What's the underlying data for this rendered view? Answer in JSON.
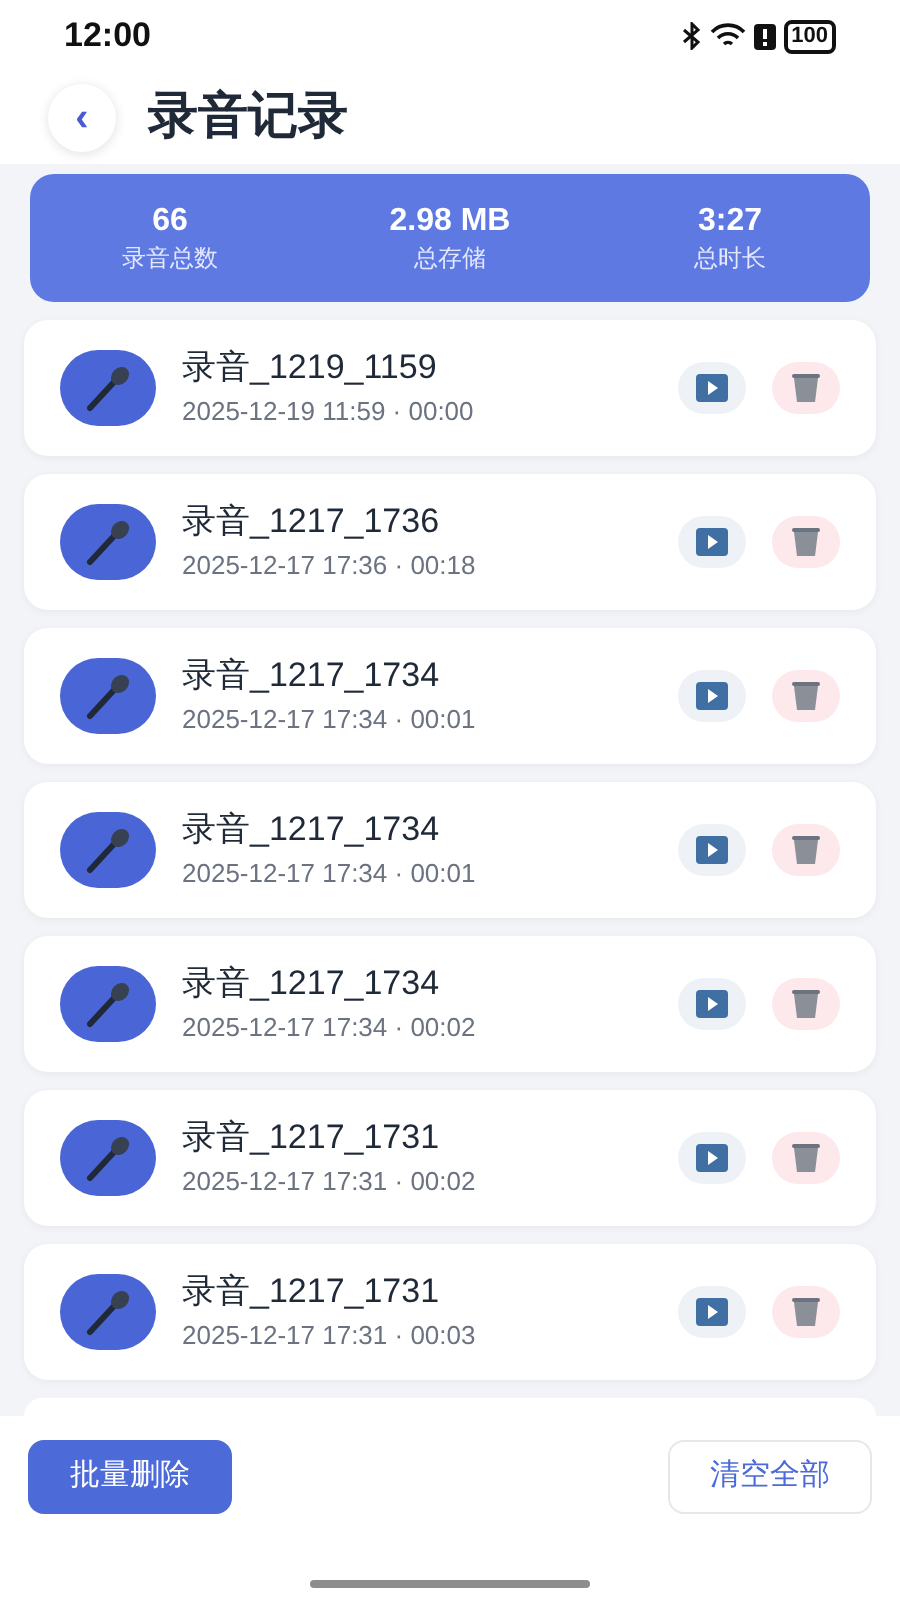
{
  "status_bar": {
    "time": "12:00",
    "battery": "100"
  },
  "header": {
    "back": "‹",
    "title": "录音记录"
  },
  "stats": [
    {
      "value": "66",
      "label": "录音总数"
    },
    {
      "value": "2.98 MB",
      "label": "总存储"
    },
    {
      "value": "3:27",
      "label": "总时长"
    }
  ],
  "recordings": [
    {
      "name": "录音_1219_1159",
      "meta": "2025-12-19 11:59 · 00:00"
    },
    {
      "name": "录音_1217_1736",
      "meta": "2025-12-17 17:36 · 00:18"
    },
    {
      "name": "录音_1217_1734",
      "meta": "2025-12-17 17:34 · 00:01"
    },
    {
      "name": "录音_1217_1734",
      "meta": "2025-12-17 17:34 · 00:01"
    },
    {
      "name": "录音_1217_1734",
      "meta": "2025-12-17 17:34 · 00:02"
    },
    {
      "name": "录音_1217_1731",
      "meta": "2025-12-17 17:31 · 00:02"
    },
    {
      "name": "录音_1217_1731",
      "meta": "2025-12-17 17:31 · 00:03"
    }
  ],
  "bottom_bar": {
    "batch_delete": "批量删除",
    "clear_all": "清空全部"
  }
}
